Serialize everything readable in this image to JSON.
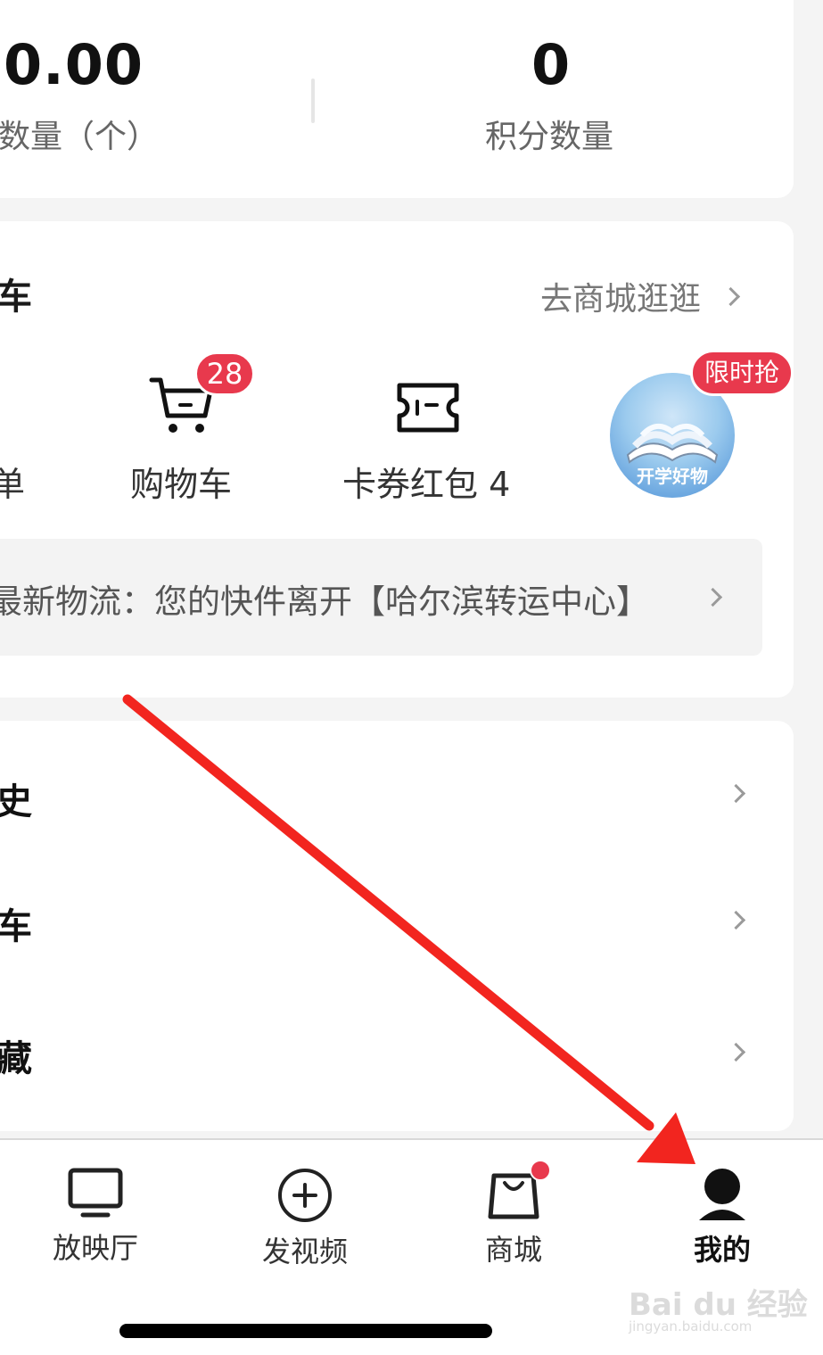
{
  "stats": {
    "coins_value": "0.00",
    "coins_label": "宝数量（个）",
    "points_value": "0",
    "points_label": "积分数量"
  },
  "shop": {
    "header_edge": "车",
    "go_shop_label": "去商城逛逛",
    "edge_item_label": "单",
    "cart_label": "购物车",
    "cart_badge": "28",
    "coupons_label": "卡券红包 4",
    "promo_badge": "限时抢",
    "promo_caption": "开学好物",
    "logistics_text": "最新物流：您的快件离开【哈尔滨转运中心】"
  },
  "menu": {
    "items": [
      {
        "edge_label": "史"
      },
      {
        "edge_label": "车"
      },
      {
        "edge_label": "藏"
      }
    ]
  },
  "nav": {
    "items": [
      {
        "label": "放映厅",
        "icon": "tv-icon"
      },
      {
        "label": "发视频",
        "icon": "plus-circle-icon"
      },
      {
        "label": "商城",
        "icon": "shopping-bag-icon"
      },
      {
        "label": "我的",
        "icon": "user-icon",
        "active": true
      }
    ]
  },
  "watermark": {
    "brand": "Bai du 经验",
    "url": "jingyan.baidu.com"
  },
  "colors": {
    "badge_red": "#e8394d",
    "arrow_red": "#f2251f",
    "active_nav": "#111111"
  }
}
